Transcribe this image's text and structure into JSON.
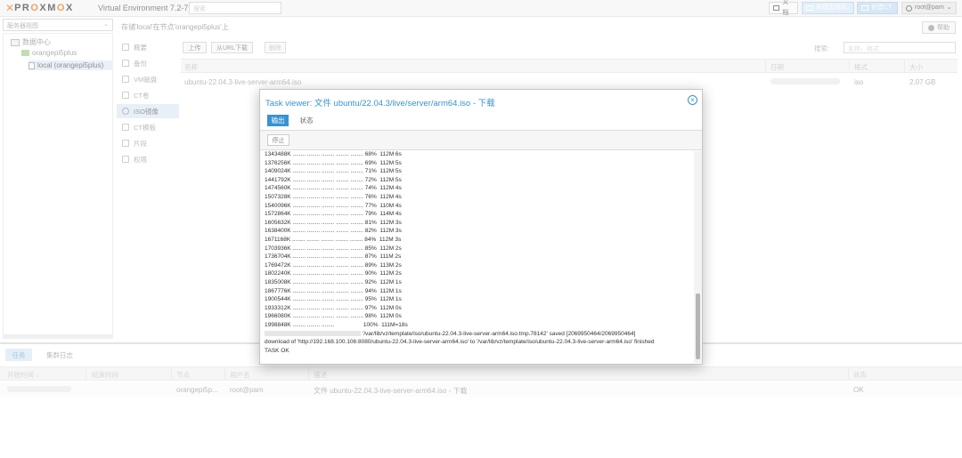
{
  "header": {
    "logo_x": "✕",
    "logo_pre": "PR",
    "logo_o1": "O",
    "logo_mid": "XM",
    "logo_o2": "O",
    "logo_post": "X",
    "version": "Virtual Environment 7.2-7",
    "search_placeholder": "搜索",
    "docs_label": "文档",
    "create_vm_label": "创建虚拟机",
    "create_ct_label": "创建CT",
    "user_label": "root@pam"
  },
  "tree": {
    "view": "服务器视图",
    "datacenter": "数据中心",
    "node": "orangepi5plus",
    "storage": "local (orangepi5plus)"
  },
  "content": {
    "title": "存储'local'在节点'orangepi5plus'上",
    "help_label": "帮助",
    "nav": [
      "概要",
      "备份",
      "VM磁盘",
      "CT卷",
      "ISO镜像",
      "CT模板",
      "片段",
      "权限"
    ],
    "toolbar": {
      "upload": "上传",
      "download_url": "从URL下载",
      "remove": "删除",
      "search_label": "搜索:",
      "search_placeholder": "名称、格式"
    },
    "grid": {
      "columns": [
        "名称",
        "日期",
        "格式",
        "大小"
      ],
      "rows": [
        {
          "name": "ubuntu-22.04.3-live-server-arm64.iso",
          "format": "iso",
          "size": "2.07 GB"
        }
      ]
    }
  },
  "task_viewer": {
    "title": "Task viewer: 文件 ubuntu/22.04.3/live/server/arm64.iso - 下载",
    "tab_output": "输出",
    "tab_status": "状态",
    "stop_label": "停止",
    "log_lines": [
      "1343488K ........ ........ ........ ........ ........ 68%  112M 6s",
      "1376256K ........ ........ ........ ........ ........ 69%  112M 5s",
      "1409024K ........ ........ ........ ........ ........ 71%  112M 5s",
      "1441792K ........ ........ ........ ........ ........ 72%  112M 5s",
      "1474560K ........ ........ ........ ........ ........ 74%  112M 4s",
      "1507328K ........ ........ ........ ........ ........ 76%  112M 4s",
      "1540096K ........ ........ ........ ........ ........ 77%  110M 4s",
      "1572864K ........ ........ ........ ........ ........ 79%  114M 4s",
      "1605632K ........ ........ ........ ........ ........ 81%  112M 3s",
      "1638400K ........ ........ ........ ........ ........ 82%  112M 3s",
      "1671168K ........ ........ ........ ........ ........ 84%  112M 3s",
      "1703936K ........ ........ ........ ........ ........ 85%  112M 2s",
      "1736704K ........ ........ ........ ........ ........ 87%  111M 2s",
      "1769472K ........ ........ ........ ........ ........ 89%  113M 2s",
      "1802240K ........ ........ ........ ........ ........ 90%  112M 2s",
      "1835008K ........ ........ ........ ........ ........ 92%  112M 1s",
      "1867776K ........ ........ ........ ........ ........ 94%  112M 1s",
      "1900544K ........ ........ ........ ........ ........ 95%  112M 1s",
      "1933312K ........ ........ ........ ........ ........ 97%  112M 0s",
      "1966080K ........ ........ ........ ........ ........ 98%  112M 0s",
      "1998848K ........ ........ ........                  100%  111M=18s"
    ],
    "saved_line": "'/var/lib/vz/template/iso/ubuntu-22.04.3-live-server-arm64.iso.tmp.78142' saved [2069950464/2069950464]",
    "download_line": "download of 'http://192.168.100.106:8080/ubuntu-22.04.3-live-server-arm64.iso' to '/var/lib/vz/template/iso/ubuntu-22.04.3-live-server-arm64.iso' finished",
    "ok_line": "TASK OK"
  },
  "bottom": {
    "tab_tasks": "任务",
    "tab_cluster_log": "集群日志",
    "columns": [
      "开始时间 ↓",
      "结束时间",
      "节点",
      "用户名",
      "描述",
      "状态"
    ],
    "row": {
      "node": "orangepi5p...",
      "user": "root@pam",
      "description": "文件 ubuntu-22.04.3-live-server-arm64.iso - 下载",
      "status": "OK"
    }
  }
}
